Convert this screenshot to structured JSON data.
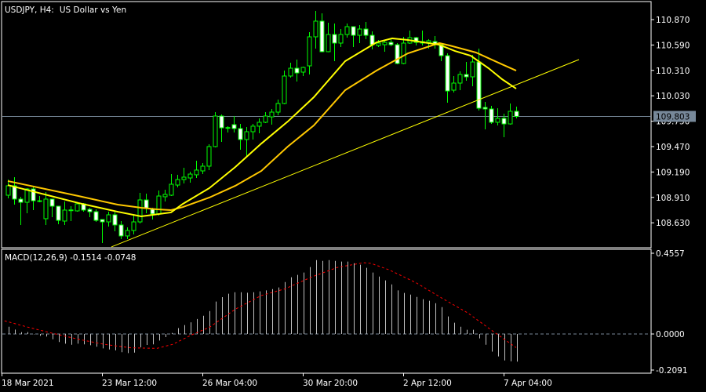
{
  "header": {
    "symbol": "USDJPY, H4:",
    "description": "US Dollar vs Yen"
  },
  "colors": {
    "background": "#000000",
    "frame": "#FFFFFF",
    "bull_outline": "#00FF00",
    "bear_fill": "#FFFFFF",
    "fast_ma": "#FFFF00",
    "slow_ma": "#FFC800",
    "trendline": "#FFFF00",
    "bid_line": "#778899",
    "histogram": "#C0C0C0",
    "signal": "#FF0000"
  },
  "price_axis": {
    "ticks": [
      "110.870",
      "110.590",
      "110.310",
      "110.030",
      "109.750",
      "109.470",
      "109.190",
      "108.910",
      "108.630"
    ],
    "bid": "109.803"
  },
  "time_axis": [
    {
      "label": "18 Mar 2021",
      "bar": -1
    },
    {
      "label": "23 Mar 12:00",
      "bar": 15
    },
    {
      "label": "26 Mar 04:00",
      "bar": 31
    },
    {
      "label": "30 Mar 20:00",
      "bar": 47
    },
    {
      "label": "2 Apr 12:00",
      "bar": 63
    },
    {
      "label": "7 Apr 04:00",
      "bar": 79
    }
  ],
  "macd": {
    "label": "MACD(12,26,9) -0.1514 -0.0748",
    "axis": [
      "0.4557",
      "0.0000",
      "-0.2091"
    ]
  },
  "chart_data": {
    "type": "candlestick",
    "title": "USDJPY, H4",
    "ylim": [
      108.35,
      111.05
    ],
    "ohlc": [
      [
        108.934,
        109.107,
        108.899,
        109.038
      ],
      [
        109.038,
        109.133,
        108.83,
        108.891
      ],
      [
        108.891,
        108.917,
        108.606,
        108.856
      ],
      [
        108.856,
        109.012,
        108.735,
        109.003
      ],
      [
        109.003,
        109.029,
        108.77,
        108.873
      ],
      [
        108.873,
        108.925,
        108.856,
        108.87
      ],
      [
        108.675,
        108.969,
        108.606,
        108.891
      ],
      [
        108.891,
        108.895,
        108.692,
        108.813
      ],
      [
        108.813,
        108.815,
        108.614,
        108.657
      ],
      [
        108.649,
        108.865,
        108.606,
        108.77
      ],
      [
        108.77,
        108.813,
        108.649,
        108.772
      ],
      [
        108.761,
        108.848,
        108.752,
        108.839
      ],
      [
        108.839,
        108.848,
        108.752,
        108.77
      ],
      [
        108.778,
        108.796,
        108.692,
        108.752
      ],
      [
        108.752,
        108.778,
        108.64,
        108.657
      ],
      [
        108.666,
        108.668,
        108.407,
        108.64
      ],
      [
        108.64,
        108.752,
        108.588,
        108.718
      ],
      [
        108.718,
        108.752,
        108.536,
        108.606
      ],
      [
        108.606,
        108.649,
        108.45,
        108.485
      ],
      [
        108.485,
        108.58,
        108.45,
        108.545
      ],
      [
        108.545,
        108.718,
        108.502,
        108.64
      ],
      [
        108.64,
        108.96,
        108.623,
        108.882
      ],
      [
        108.882,
        108.951,
        108.735,
        108.787
      ],
      [
        108.778,
        108.796,
        108.666,
        108.727
      ],
      [
        108.727,
        108.986,
        108.709,
        108.925
      ],
      [
        108.917,
        108.994,
        108.865,
        108.943
      ],
      [
        108.934,
        109.167,
        108.925,
        109.055
      ],
      [
        109.046,
        109.159,
        109.02,
        109.107
      ],
      [
        109.107,
        109.236,
        109.064,
        109.133
      ],
      [
        109.124,
        109.193,
        109.072,
        109.167
      ],
      [
        109.159,
        109.314,
        109.124,
        109.211
      ],
      [
        109.202,
        109.288,
        109.167,
        109.254
      ],
      [
        109.254,
        109.496,
        109.211,
        109.47
      ],
      [
        109.47,
        109.85,
        109.461,
        109.807
      ],
      [
        109.807,
        109.824,
        109.522,
        109.677
      ],
      [
        109.677,
        109.695,
        109.625,
        109.68
      ],
      [
        109.712,
        109.807,
        109.625,
        109.669
      ],
      [
        109.669,
        109.72,
        109.435,
        109.548
      ],
      [
        109.548,
        109.686,
        109.366,
        109.634
      ],
      [
        109.634,
        109.72,
        109.548,
        109.695
      ],
      [
        109.695,
        109.781,
        109.617,
        109.738
      ],
      [
        109.738,
        109.85,
        109.729,
        109.807
      ],
      [
        109.798,
        109.885,
        109.712,
        109.85
      ],
      [
        109.85,
        109.988,
        109.816,
        109.945
      ],
      [
        109.945,
        110.308,
        109.937,
        110.248
      ],
      [
        110.248,
        110.395,
        110.23,
        110.334
      ],
      [
        110.334,
        110.429,
        110.187,
        110.282
      ],
      [
        110.291,
        110.351,
        110.248,
        110.343
      ],
      [
        110.36,
        110.732,
        110.265,
        110.68
      ],
      [
        110.68,
        110.965,
        110.55,
        110.853
      ],
      [
        110.853,
        110.939,
        110.51,
        110.516
      ],
      [
        110.516,
        110.835,
        110.51,
        110.706
      ],
      [
        110.706,
        110.827,
        110.412,
        110.611
      ],
      [
        110.611,
        110.766,
        110.567,
        110.706
      ],
      [
        110.706,
        110.827,
        110.671,
        110.792
      ],
      [
        110.792,
        110.795,
        110.567,
        110.697
      ],
      [
        110.697,
        110.809,
        110.611,
        110.766
      ],
      [
        110.766,
        110.844,
        110.654,
        110.697
      ],
      [
        110.697,
        110.74,
        110.542,
        110.593
      ],
      [
        110.585,
        110.645,
        110.567,
        110.611
      ],
      [
        110.593,
        110.637,
        110.516,
        110.619
      ],
      [
        110.619,
        110.654,
        110.576,
        110.593
      ],
      [
        110.593,
        110.611,
        110.377,
        110.386
      ],
      [
        110.386,
        110.68,
        110.377,
        110.611
      ],
      [
        110.611,
        110.749,
        110.602,
        110.671
      ],
      [
        110.671,
        110.68,
        110.585,
        110.619
      ],
      [
        110.611,
        110.749,
        110.585,
        110.628
      ],
      [
        110.619,
        110.654,
        110.55,
        110.637
      ],
      [
        110.628,
        110.688,
        110.55,
        110.593
      ],
      [
        110.593,
        110.611,
        110.412,
        110.472
      ],
      [
        110.472,
        110.498,
        109.954,
        110.083
      ],
      [
        110.092,
        110.248,
        110.066,
        110.17
      ],
      [
        110.17,
        110.3,
        110.092,
        110.265
      ],
      [
        110.265,
        110.403,
        110.196,
        110.239
      ],
      [
        110.239,
        110.481,
        110.135,
        110.403
      ],
      [
        110.403,
        110.55,
        109.867,
        109.893
      ],
      [
        109.902,
        109.962,
        109.66,
        109.885
      ],
      [
        109.885,
        109.919,
        109.72,
        109.738
      ],
      [
        109.738,
        109.893,
        109.703,
        109.781
      ],
      [
        109.781,
        109.833,
        109.574,
        109.72
      ],
      [
        109.72,
        109.945,
        109.712,
        109.859
      ],
      [
        109.859,
        109.911,
        109.781,
        109.803
      ]
    ],
    "fast_ma": [
      [
        0,
        109.046
      ],
      [
        11.25,
        108.848
      ],
      [
        17.5,
        108.752
      ],
      [
        21.25,
        108.701
      ],
      [
        26,
        108.744
      ],
      [
        27.9,
        108.839
      ],
      [
        32.1,
        109.012
      ],
      [
        36.25,
        109.245
      ],
      [
        40.4,
        109.504
      ],
      [
        44.6,
        109.746
      ],
      [
        48.75,
        110.014
      ],
      [
        53.75,
        110.412
      ],
      [
        58.75,
        110.619
      ],
      [
        61.25,
        110.663
      ],
      [
        63.75,
        110.645
      ],
      [
        68.75,
        110.593
      ],
      [
        71.25,
        110.524
      ],
      [
        73.75,
        110.472
      ],
      [
        76.6,
        110.334
      ],
      [
        78.75,
        110.213
      ],
      [
        81,
        110.109
      ]
    ],
    "slow_ma": [
      [
        0,
        109.09
      ],
      [
        11.25,
        108.925
      ],
      [
        17.5,
        108.83
      ],
      [
        21.25,
        108.796
      ],
      [
        23.75,
        108.778
      ],
      [
        26,
        108.77
      ],
      [
        27.9,
        108.804
      ],
      [
        32.1,
        108.908
      ],
      [
        36.25,
        109.038
      ],
      [
        40.4,
        109.202
      ],
      [
        44.6,
        109.47
      ],
      [
        48.75,
        109.703
      ],
      [
        53.75,
        110.092
      ],
      [
        58.75,
        110.308
      ],
      [
        61.25,
        110.403
      ],
      [
        63.75,
        110.498
      ],
      [
        68.75,
        110.611
      ],
      [
        70.4,
        110.585
      ],
      [
        74.6,
        110.507
      ],
      [
        78.75,
        110.377
      ],
      [
        81,
        110.308
      ]
    ],
    "trendline": [
      [
        16.5,
        108.364
      ],
      [
        91,
        110.429
      ]
    ],
    "macd_ylim": [
      -0.2091,
      0.4557
    ],
    "macd_hist": [
      0.04,
      0.024,
      0.01,
      0.011,
      -0.002,
      -0.01,
      -0.014,
      -0.029,
      -0.044,
      -0.053,
      -0.059,
      -0.053,
      -0.057,
      -0.062,
      -0.07,
      -0.079,
      -0.085,
      -0.09,
      -0.1,
      -0.105,
      -0.102,
      -0.073,
      -0.06,
      -0.057,
      -0.036,
      -0.017,
      0.006,
      0.032,
      0.049,
      0.064,
      0.082,
      0.1,
      0.126,
      0.178,
      0.202,
      0.221,
      0.229,
      0.229,
      0.226,
      0.229,
      0.234,
      0.239,
      0.246,
      0.255,
      0.285,
      0.311,
      0.324,
      0.337,
      0.367,
      0.405,
      0.401,
      0.405,
      0.401,
      0.397,
      0.397,
      0.388,
      0.38,
      0.363,
      0.337,
      0.315,
      0.294,
      0.272,
      0.239,
      0.225,
      0.216,
      0.203,
      0.191,
      0.182,
      0.169,
      0.147,
      0.096,
      0.062,
      0.04,
      0.023,
      0.023,
      -0.024,
      -0.059,
      -0.097,
      -0.123,
      -0.145,
      -0.15,
      -0.1514
    ],
    "macd_signal": [
      [
        -1.25,
        0.079
      ],
      [
        2.9,
        0.04
      ],
      [
        7.1,
        0.004
      ],
      [
        11.25,
        -0.029
      ],
      [
        15.4,
        -0.057
      ],
      [
        19.6,
        -0.076
      ],
      [
        23.75,
        -0.079
      ],
      [
        26.25,
        -0.057
      ],
      [
        29.6,
        0.0
      ],
      [
        32.1,
        0.036
      ],
      [
        36.25,
        0.136
      ],
      [
        40.4,
        0.211
      ],
      [
        44.2,
        0.248
      ],
      [
        48.3,
        0.311
      ],
      [
        52.5,
        0.365
      ],
      [
        56.7,
        0.391
      ],
      [
        57.9,
        0.387
      ],
      [
        60.8,
        0.351
      ],
      [
        65,
        0.282
      ],
      [
        69.2,
        0.196
      ],
      [
        73.3,
        0.115
      ],
      [
        77.5,
        0.01
      ],
      [
        81,
        -0.0748
      ]
    ]
  }
}
